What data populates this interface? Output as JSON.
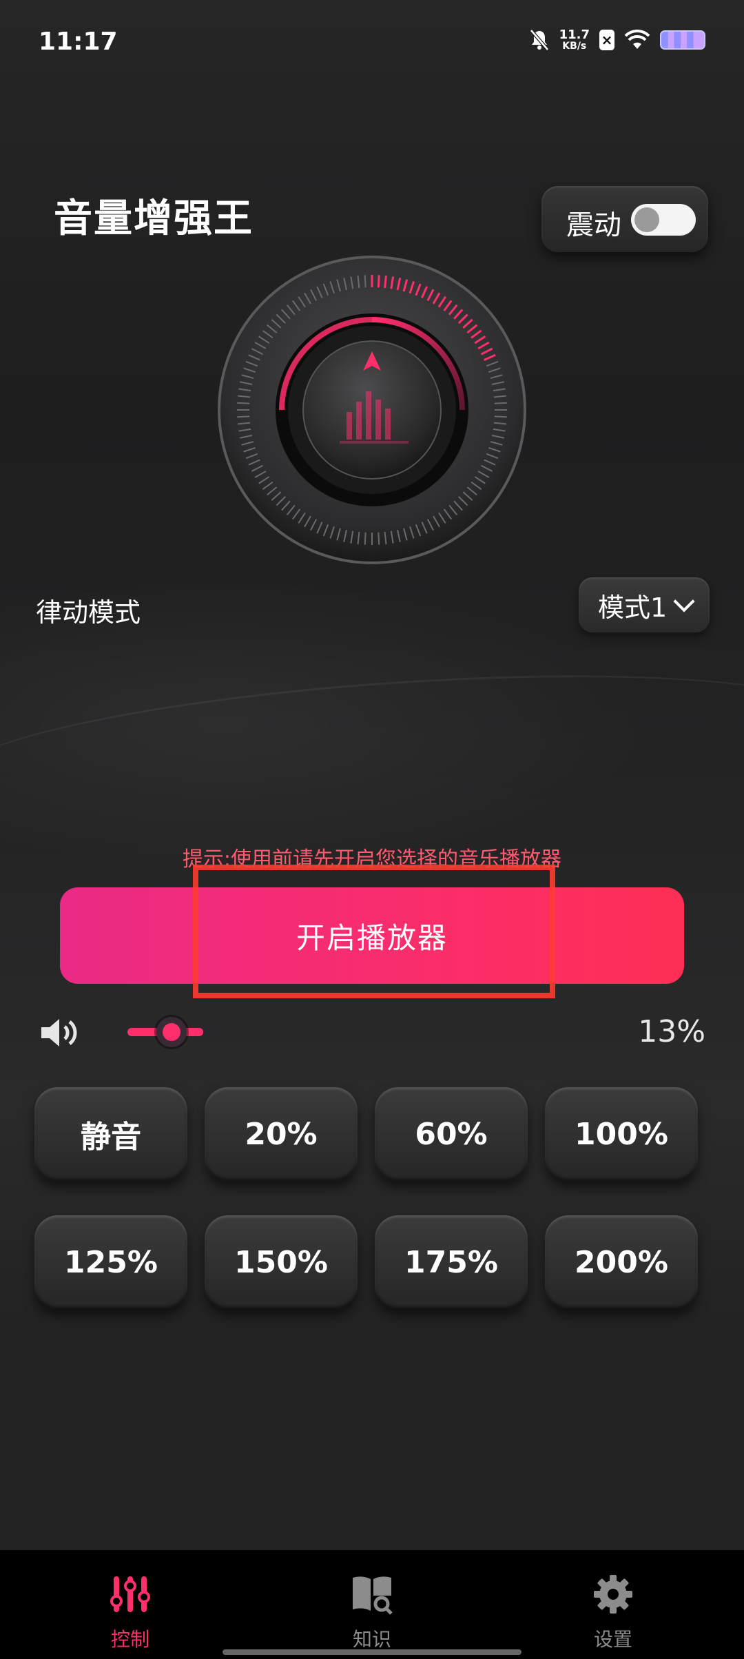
{
  "status_bar": {
    "time": "11:17",
    "net_speed_value": "11.7",
    "net_speed_unit": "KB/s",
    "icons": [
      "mute-bell-icon",
      "sim-x-icon",
      "wifi-icon",
      "battery-icon"
    ]
  },
  "header": {
    "title": "音量增强王",
    "vibrate_label": "震动",
    "vibrate_on": false
  },
  "knob": {
    "accent": "#ff2f6c"
  },
  "rhythm": {
    "label": "律动模式",
    "mode_selected": "模式1"
  },
  "hint": "提示:使用前请先开启您选择的音乐播放器",
  "start_button_label": "开启播放器",
  "volume": {
    "percent_label": "13%",
    "level": 0.13
  },
  "presets": [
    "静音",
    "20%",
    "60%",
    "100%",
    "125%",
    "150%",
    "175%",
    "200%"
  ],
  "nav": {
    "items": [
      {
        "label": "控制",
        "icon": "equalizer-icon",
        "active": true
      },
      {
        "label": "知识",
        "icon": "book-search-icon",
        "active": false
      },
      {
        "label": "设置",
        "icon": "gear-icon",
        "active": false
      }
    ]
  },
  "colors": {
    "accent": "#ff2f6c",
    "hint": "#ff5a6e",
    "background": "#1f1f20",
    "nav_inactive": "#8c8c8c"
  }
}
